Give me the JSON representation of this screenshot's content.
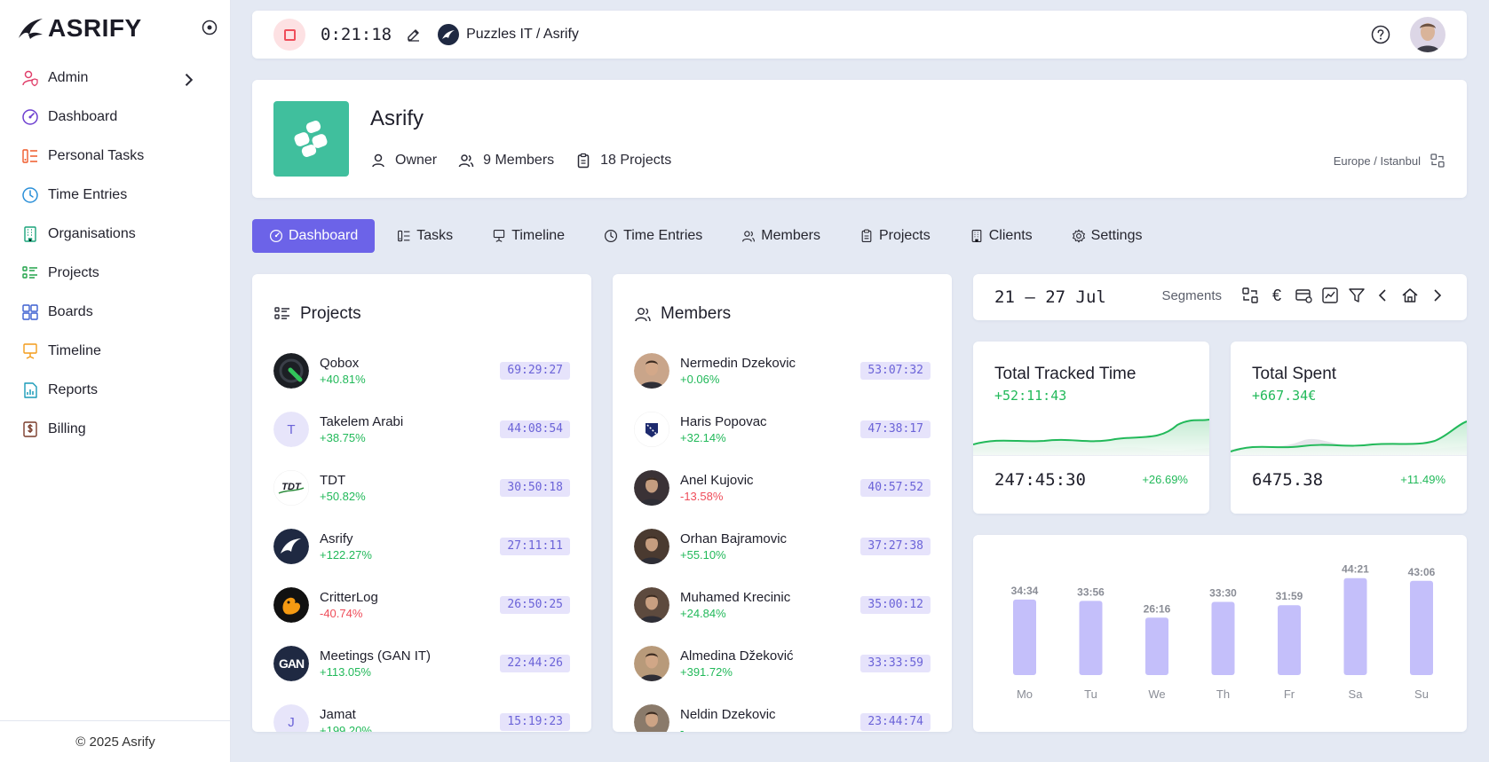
{
  "app": {
    "name": "ASRIFY",
    "footer": "© 2025 Asrify",
    "brand_color": "#6c63e8"
  },
  "sidebar": {
    "items": [
      {
        "label": "Admin",
        "icon": "user-shield-icon",
        "color": "#e0406b",
        "has_chevron": true
      },
      {
        "label": "Dashboard",
        "icon": "dashboard-icon",
        "color": "#6d3fd0"
      },
      {
        "label": "Personal Tasks",
        "icon": "tasks-icon",
        "color": "#ef5a2a"
      },
      {
        "label": "Time Entries",
        "icon": "clock-icon",
        "color": "#2a8fd8"
      },
      {
        "label": "Organisations",
        "icon": "building-icon",
        "color": "#1aa37a"
      },
      {
        "label": "Projects",
        "icon": "list-icon",
        "color": "#22a34a"
      },
      {
        "label": "Boards",
        "icon": "grid-icon",
        "color": "#3b5fd0"
      },
      {
        "label": "Timeline",
        "icon": "presentation-icon",
        "color": "#f39c1a"
      },
      {
        "label": "Reports",
        "icon": "report-icon",
        "color": "#1a9bb8"
      },
      {
        "label": "Billing",
        "icon": "dollar-doc-icon",
        "color": "#7a3b2a"
      }
    ]
  },
  "topbar": {
    "timer": "0:21:18",
    "workspace": "Puzzles IT / Asrify"
  },
  "org": {
    "name": "Asrify",
    "role": "Owner",
    "members": "9 Members",
    "projects": "18 Projects",
    "timezone": "Europe / Istanbul"
  },
  "tabs": [
    {
      "label": "Dashboard",
      "icon": "dashboard-icon",
      "active": true
    },
    {
      "label": "Tasks",
      "icon": "tasks-icon"
    },
    {
      "label": "Timeline",
      "icon": "presentation-icon"
    },
    {
      "label": "Time Entries",
      "icon": "clock-icon"
    },
    {
      "label": "Members",
      "icon": "users-icon"
    },
    {
      "label": "Projects",
      "icon": "clipboard-icon"
    },
    {
      "label": "Clients",
      "icon": "building-icon"
    },
    {
      "label": "Settings",
      "icon": "gear-icon"
    }
  ],
  "projects_card": {
    "title": "Projects",
    "items": [
      {
        "name": "Qobox",
        "pct": "+40.81%",
        "trend": "pos",
        "time": "69:29:27",
        "avatar": "qobox"
      },
      {
        "name": "Takelem Arabi",
        "pct": "+38.75%",
        "trend": "pos",
        "time": "44:08:54",
        "avatar": "letter",
        "letter": "T"
      },
      {
        "name": "TDT",
        "pct": "+50.82%",
        "trend": "pos",
        "time": "30:50:18",
        "avatar": "tdt"
      },
      {
        "name": "Asrify",
        "pct": "+122.27%",
        "trend": "pos",
        "time": "27:11:11",
        "avatar": "asrify"
      },
      {
        "name": "CritterLog",
        "pct": "-40.74%",
        "trend": "neg",
        "time": "26:50:25",
        "avatar": "critter"
      },
      {
        "name": "Meetings (GAN IT)",
        "pct": "+113.05%",
        "trend": "pos",
        "time": "22:44:26",
        "avatar": "gan"
      },
      {
        "name": "Jamat",
        "pct": "+199.20%",
        "trend": "pos",
        "time": "15:19:23",
        "avatar": "letter",
        "letter": "J"
      }
    ]
  },
  "members_card": {
    "title": "Members",
    "items": [
      {
        "name": "Nermedin Dzekovic",
        "pct": "+0.06%",
        "trend": "pos",
        "time": "53:07:32",
        "avatar": "#c9a58a"
      },
      {
        "name": "Haris Popovac",
        "pct": "+32.14%",
        "trend": "pos",
        "time": "47:38:17",
        "avatar": "flag"
      },
      {
        "name": "Anel Kujovic",
        "pct": "-13.58%",
        "trend": "neg",
        "time": "40:57:52",
        "avatar": "#3a3236"
      },
      {
        "name": "Orhan Bajramovic",
        "pct": "+55.10%",
        "trend": "pos",
        "time": "37:27:38",
        "avatar": "#4a3a30"
      },
      {
        "name": "Muhamed Krecinic",
        "pct": "+24.84%",
        "trend": "pos",
        "time": "35:00:12",
        "avatar": "#5d4a3e"
      },
      {
        "name": "Almedina Džeković",
        "pct": "+391.72%",
        "trend": "pos",
        "time": "33:33:59",
        "avatar": "#b89a7a"
      },
      {
        "name": "Neldin Dzekovic",
        "pct": "-",
        "trend": "dash",
        "time": "23:44:74",
        "avatar": "#8a7a6a"
      }
    ]
  },
  "range": {
    "label": "21 – 27 Jul",
    "segments_label": "Segments",
    "currency_symbol": "€"
  },
  "tracked": {
    "title": "Total Tracked Time",
    "delta": "+52:11:43",
    "total": "247:45:30",
    "pct": "+26.69%"
  },
  "spent": {
    "title": "Total Spent",
    "delta": "+667.34€",
    "total": "6475.38",
    "pct": "+11.49%"
  },
  "chart_data": {
    "type": "bar",
    "categories": [
      "Mo",
      "Tu",
      "We",
      "Th",
      "Fr",
      "Sa",
      "Su"
    ],
    "values": [
      34.57,
      33.93,
      26.27,
      33.5,
      31.98,
      44.35,
      43.1
    ],
    "labels": [
      "34:34",
      "33:56",
      "26:16",
      "33:30",
      "31:59",
      "44:21",
      "43:06"
    ],
    "ylim": [
      0,
      50
    ],
    "color": "#c4bffa",
    "grid": false
  }
}
